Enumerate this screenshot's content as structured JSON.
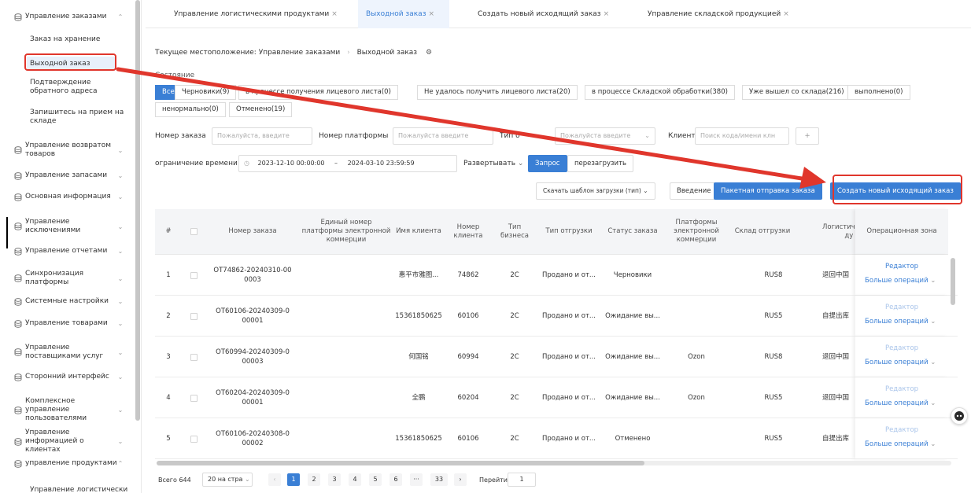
{
  "sidebar": {
    "groups": [
      {
        "label": "Управление заказами",
        "expanded": true
      },
      {
        "label": "Управление возвратом товаров",
        "expanded": false
      },
      {
        "label": "Управление запасами",
        "expanded": false
      },
      {
        "label": "Основная информация",
        "expanded": false
      },
      {
        "label": "Управление исключениями",
        "expanded": false
      },
      {
        "label": "Управление отчетами",
        "expanded": false
      },
      {
        "label": "Синхронизация платформы",
        "expanded": false
      },
      {
        "label": "Системные настройки",
        "expanded": false
      },
      {
        "label": "Управление товарами",
        "expanded": false
      },
      {
        "label": "Управление поставщиками услуг",
        "expanded": false
      },
      {
        "label": "Сторонний интерфейс",
        "expanded": false
      },
      {
        "label": "Комплексное управление пользователями",
        "expanded": false
      },
      {
        "label": "Управление информацией о клиентах",
        "expanded": false
      },
      {
        "label": "управление продуктами",
        "expanded": true
      }
    ],
    "order_items": [
      "Заказ на хранение",
      "Выходной заказ",
      "Подтверждение обратного адреса",
      "Запишитесь на прием на складе"
    ],
    "product_items": [
      "Управление логистически"
    ]
  },
  "tabs": [
    {
      "label": "Управление логистическими продуктами",
      "active": false
    },
    {
      "label": "Выходной заказ",
      "active": true
    },
    {
      "label": "Создать новый исходящий заказ",
      "active": false
    },
    {
      "label": "Управление складской продукцией",
      "active": false
    }
  ],
  "tab_close": "×",
  "breadcrumb": {
    "prefix": "Текущее местоположение:",
    "parent": "Управление заказами",
    "current": "Выходной заказ"
  },
  "status": {
    "label": "Состояние",
    "chips": [
      "Все",
      "Черновики(9)",
      "в процессе получения лицевого листа(0)",
      "Не удалось получить лицевого листа(20)",
      "в процессе Складской обработки(380)",
      "Уже вышел со склада(216)",
      "выполнено(0)",
      "ненормально(0)",
      "Отменено(19)"
    ]
  },
  "filters": {
    "order_no_label": "Номер заказа",
    "order_no_placeholder": "Пожалуйста, введите",
    "platform_no_label": "Номер платформы",
    "platform_no_placeholder": "Пожалуйста введите",
    "type_label": "Тип о",
    "type_placeholder": "Пожалуйста введите",
    "client_label": "Клиент",
    "client_placeholder": "Поиск кода/имени клн",
    "plus": "+",
    "time_label": "ограничение времени",
    "date_from": "2023-12-10 00:00:00",
    "date_sep": "–",
    "date_to": "2024-03-10 23:59:59",
    "expand": "Развертывать",
    "query": "Запрос",
    "reset": "перезагрузить"
  },
  "actions": {
    "download_template": "Скачать шаблон загрузки (тип)",
    "import": "Введение",
    "batch_send": "Пакетная отправка заказа",
    "create": "Создать новый исходящий заказ"
  },
  "table": {
    "headers": [
      "#",
      "",
      "Номер заказа",
      "Единый номер платформы электронной коммерции",
      "Имя клиента",
      "Номер клиента",
      "Тип бизнеса",
      "Тип отгрузки",
      "Статус заказа",
      "Платформы электронной коммерции",
      "Склад отгрузки",
      "Логистические ду",
      "Операционная зона"
    ],
    "rows": [
      {
        "n": "1",
        "order": [
          "OT74862-20240310-00",
          "0003"
        ],
        "platform_no": "",
        "client": "惠平市雅图...",
        "client_no": "74862",
        "biz": "2C",
        "ship_type": "Продано и от...",
        "status": "Черновики",
        "platform": "",
        "warehouse": "RUS8",
        "logistics": "退回中国"
      },
      {
        "n": "2",
        "order": [
          "OT60106-20240309-0",
          "00001"
        ],
        "platform_no": "",
        "client": "15361850625",
        "client_no": "60106",
        "biz": "2C",
        "ship_type": "Продано и от...",
        "status": "Ожидание вы...",
        "platform": "",
        "warehouse": "RUS5",
        "logistics": "自提出库"
      },
      {
        "n": "3",
        "order": [
          "OT60994-20240309-0",
          "00003"
        ],
        "platform_no": "",
        "client": "何国铭",
        "client_no": "60994",
        "biz": "2C",
        "ship_type": "Продано и от...",
        "status": "Ожидание вы...",
        "platform": "Ozon",
        "warehouse": "RUS8",
        "logistics": "退回中国"
      },
      {
        "n": "4",
        "order": [
          "OT60204-20240309-0",
          "00001"
        ],
        "platform_no": "",
        "client": "全鹏",
        "client_no": "60204",
        "biz": "2C",
        "ship_type": "Продано и от...",
        "status": "Ожидание вы...",
        "platform": "Ozon",
        "warehouse": "RUS5",
        "logistics": "退回中国"
      },
      {
        "n": "5",
        "order": [
          "OT60106-20240308-0",
          "00002"
        ],
        "platform_no": "",
        "client": "15361850625",
        "client_no": "60106",
        "biz": "2C",
        "ship_type": "Продано и от...",
        "status": "Отменено",
        "platform": "",
        "warehouse": "RUS5",
        "logistics": "自提出库"
      }
    ],
    "op_edit": "Редактор",
    "op_more": "Больше операций"
  },
  "pagination": {
    "total": "Всего 644",
    "page_size": "20 на стра",
    "pages": [
      "1",
      "2",
      "3",
      "4",
      "5",
      "6",
      "···",
      "33"
    ],
    "prev": "‹",
    "next": "›",
    "goto_label": "Перейти",
    "goto_value": "1"
  },
  "colors": {
    "primary": "#3a7fd5",
    "annotation": "#e0362c"
  }
}
